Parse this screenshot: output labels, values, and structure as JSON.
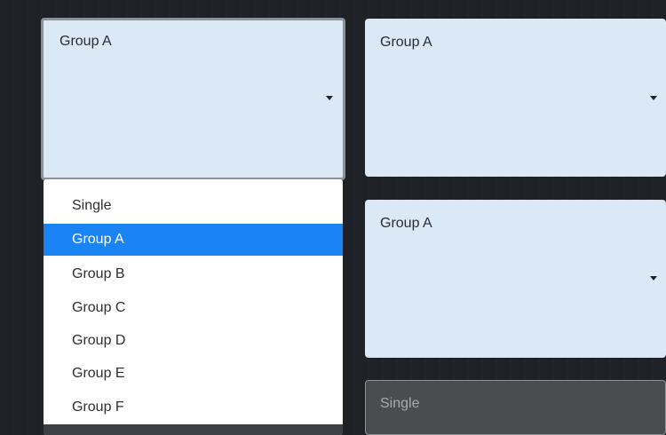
{
  "selects": [
    {
      "value": "Group A",
      "state": "open"
    },
    {
      "value": "Group A"
    },
    {
      "value": "Group A"
    },
    {
      "value": "Single",
      "state": "disabled"
    }
  ],
  "dropdown": {
    "options": [
      "Single",
      "Group A",
      "Group B",
      "Group C",
      "Group D",
      "Group E",
      "Group F"
    ],
    "selected_index": 1
  },
  "colors": {
    "select_background": "#dbe8f6",
    "highlight": "#1a84f5",
    "page_background": "#1f2227",
    "disabled_background": "#4b4c50"
  },
  "icons": {
    "caret": "caret-down-icon"
  }
}
